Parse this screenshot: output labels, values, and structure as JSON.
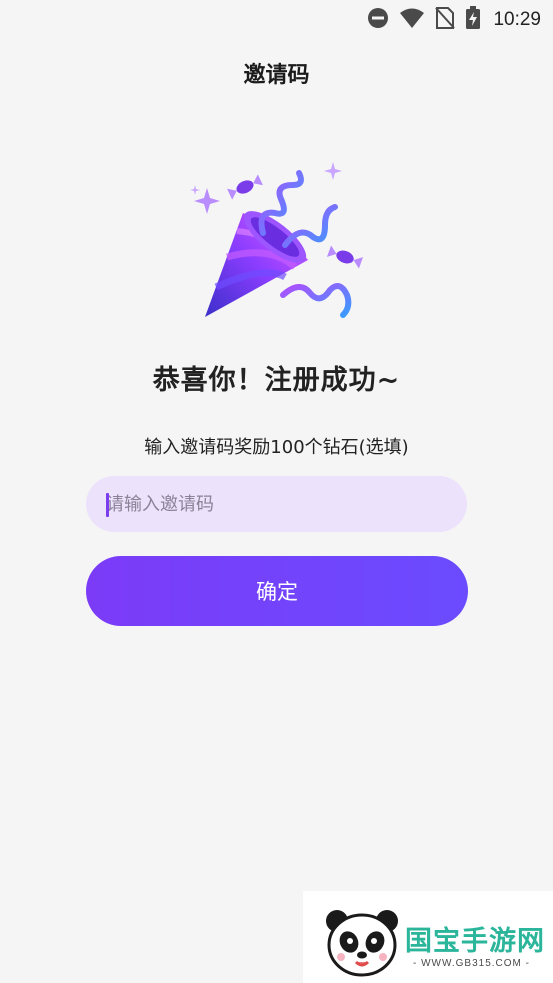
{
  "status_bar": {
    "time": "10:29",
    "icons": [
      "dnd-icon",
      "wifi-icon",
      "no-sim-icon",
      "battery-charging-icon"
    ]
  },
  "header": {
    "title": "邀请码"
  },
  "illustration": {
    "icon": "party-popper-icon",
    "colors": {
      "primary": "#8b3dff",
      "secondary": "#d457ff",
      "accent": "#3b2fc9"
    }
  },
  "main": {
    "headline": "恭喜你！注册成功~",
    "subtitle": "输入邀请码奖励100个钻石(选填)",
    "invite_input": {
      "placeholder": "请输入邀请码",
      "value": ""
    },
    "confirm_label": "确定"
  },
  "watermark": {
    "brand": "国宝手游网",
    "url": "- WWW.GB315.COM -"
  },
  "theme": {
    "accent": "#7b3bf7",
    "input_bg": "#ece2fc",
    "page_bg": "#f5f5f5"
  }
}
